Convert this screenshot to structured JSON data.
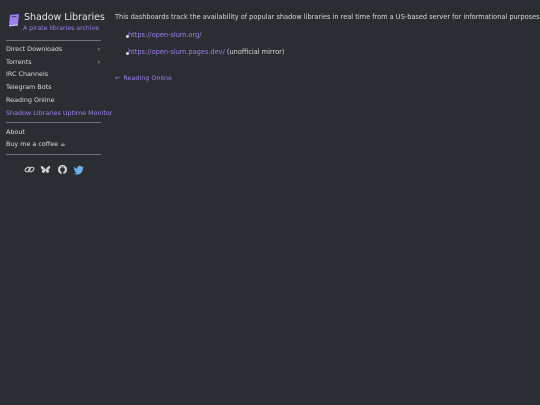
{
  "site": {
    "title": "Shadow Libraries",
    "subtitle": "A pirate libraries archive"
  },
  "nav": {
    "items": [
      {
        "label": "Direct Downloads"
      },
      {
        "label": "Torrents"
      },
      {
        "label": "IRC Channels"
      },
      {
        "label": "Telegram Bots"
      },
      {
        "label": "Reading Online"
      },
      {
        "label": "Shadow Libraries Uptime Monitor"
      }
    ],
    "secondary": [
      {
        "label": "About"
      },
      {
        "label": "Buy me a coffee"
      }
    ],
    "coffee_emoji": "☕",
    "chevron": "›"
  },
  "social": [
    {
      "icon": "link-icon"
    },
    {
      "icon": "bluesky-icon"
    },
    {
      "icon": "github-icon"
    },
    {
      "icon": "twitter-icon"
    }
  ],
  "main": {
    "intro": "This dashboards track the availability of popular shadow libraries in real time from a US-based server for informational purposes.",
    "links": [
      {
        "url": "https://open-slum.org/",
        "suffix": ""
      },
      {
        "url": "https://open-slum.pages.dev/",
        "suffix": " (unofficial mirror)"
      }
    ],
    "back_arrow": "←",
    "back_label": "Reading Online"
  },
  "colors": {
    "background": "#2a2d32",
    "accent": "#9d7ff0",
    "text": "#d6d8dc",
    "divider": "#6f7277"
  }
}
